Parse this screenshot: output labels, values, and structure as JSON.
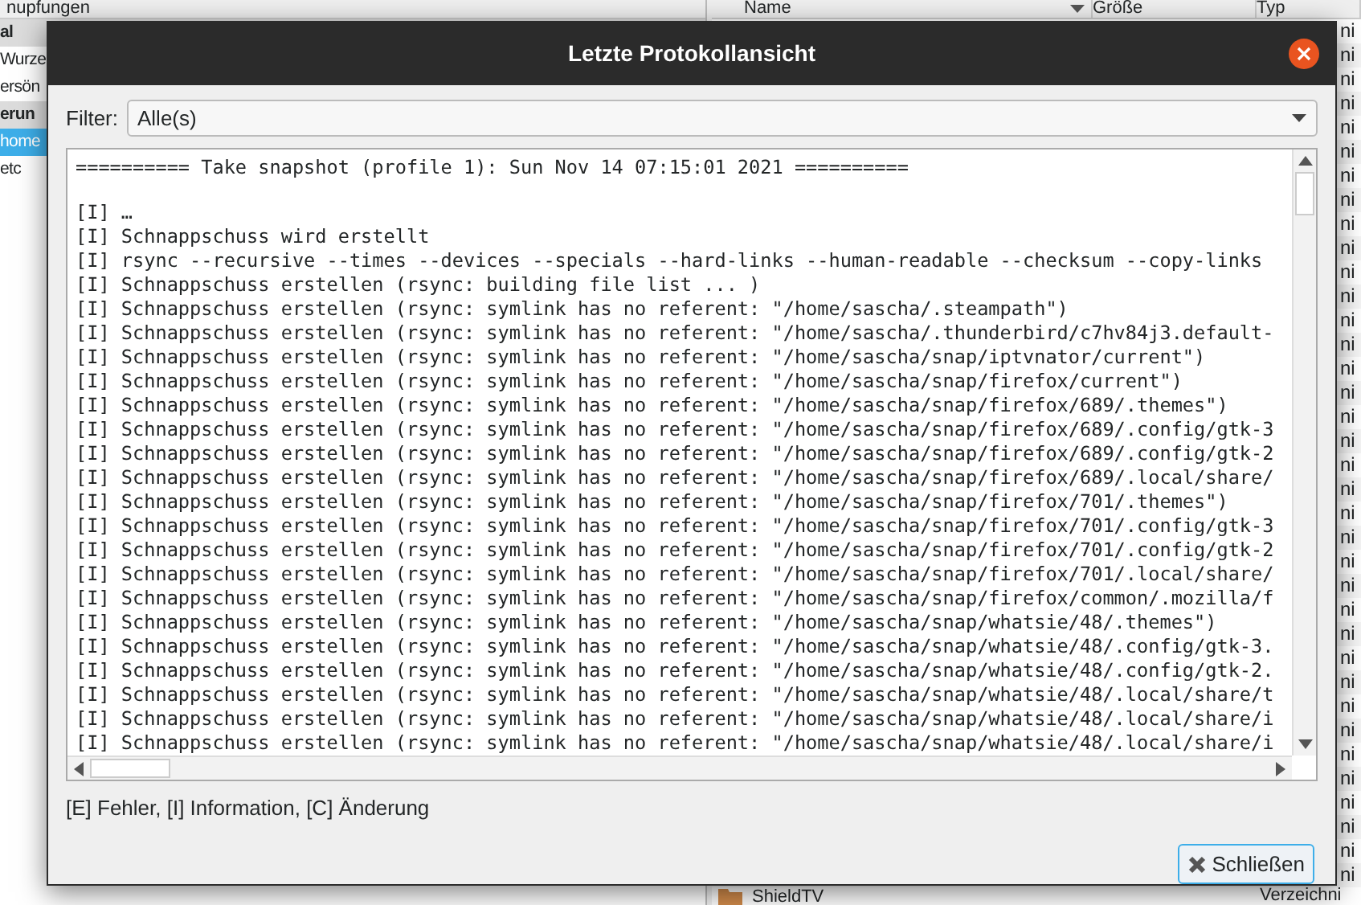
{
  "background_app": {
    "sidebar": {
      "header": "nupfungen",
      "items": [
        {
          "label": "al",
          "kind": "section",
          "selected": false
        },
        {
          "label": "Wurze",
          "kind": "item",
          "selected": false
        },
        {
          "label": "ersön",
          "kind": "item",
          "selected": false
        },
        {
          "label": "erun",
          "kind": "section",
          "selected": false
        },
        {
          "label": "home",
          "kind": "item",
          "selected": true
        },
        {
          "label": "etc",
          "kind": "item",
          "selected": false
        }
      ]
    },
    "file_list": {
      "columns": [
        "Name",
        "Größe",
        "Typ"
      ],
      "rows": [
        {
          "type": "ni"
        },
        {
          "type": "ni"
        },
        {
          "type": "ni"
        },
        {
          "type": "ni"
        },
        {
          "type": "ni"
        },
        {
          "type": "ni"
        },
        {
          "type": "ni"
        },
        {
          "type": "ni"
        },
        {
          "type": "ni"
        },
        {
          "type": "ni"
        },
        {
          "type": "ni"
        },
        {
          "type": "ni"
        },
        {
          "type": "ni"
        },
        {
          "type": "ni"
        },
        {
          "type": "ni"
        },
        {
          "type": "ni"
        },
        {
          "type": "ni"
        },
        {
          "type": "ni"
        },
        {
          "type": "ni"
        },
        {
          "type": "ni"
        },
        {
          "type": "ni"
        },
        {
          "type": "ni"
        },
        {
          "type": "ni"
        },
        {
          "type": "ni"
        },
        {
          "type": "ni"
        },
        {
          "type": "ni"
        },
        {
          "type": "ni"
        },
        {
          "type": "ni"
        },
        {
          "type": "ni"
        },
        {
          "type": "ni"
        },
        {
          "type": "ni"
        },
        {
          "type": "ni"
        },
        {
          "type": "ni"
        },
        {
          "type": "ni"
        },
        {
          "type": "ni"
        },
        {
          "type": "ni"
        },
        {
          "name": "ShieldTV",
          "type": "Verzeichni"
        }
      ]
    }
  },
  "dialog": {
    "title": "Letzte Protokollansicht",
    "filter": {
      "label": "Filter:",
      "value": "Alle(s)"
    },
    "log": {
      "header": "========== Take snapshot (profile 1): Sun Nov 14 07:15:01 2021 ==========",
      "lines": [
        "[I] …",
        "[I] Schnappschuss wird erstellt",
        "[I] rsync --recursive --times --devices --specials --hard-links --human-readable --checksum --copy-links",
        "[I] Schnappschuss erstellen (rsync: building file list ... )",
        "[I] Schnappschuss erstellen (rsync: symlink has no referent: \"/home/sascha/.steampath\")",
        "[I] Schnappschuss erstellen (rsync: symlink has no referent: \"/home/sascha/.thunderbird/c7hv84j3.default-",
        "[I] Schnappschuss erstellen (rsync: symlink has no referent: \"/home/sascha/snap/iptvnator/current\")",
        "[I] Schnappschuss erstellen (rsync: symlink has no referent: \"/home/sascha/snap/firefox/current\")",
        "[I] Schnappschuss erstellen (rsync: symlink has no referent: \"/home/sascha/snap/firefox/689/.themes\")",
        "[I] Schnappschuss erstellen (rsync: symlink has no referent: \"/home/sascha/snap/firefox/689/.config/gtk-3",
        "[I] Schnappschuss erstellen (rsync: symlink has no referent: \"/home/sascha/snap/firefox/689/.config/gtk-2",
        "[I] Schnappschuss erstellen (rsync: symlink has no referent: \"/home/sascha/snap/firefox/689/.local/share/",
        "[I] Schnappschuss erstellen (rsync: symlink has no referent: \"/home/sascha/snap/firefox/701/.themes\")",
        "[I] Schnappschuss erstellen (rsync: symlink has no referent: \"/home/sascha/snap/firefox/701/.config/gtk-3",
        "[I] Schnappschuss erstellen (rsync: symlink has no referent: \"/home/sascha/snap/firefox/701/.config/gtk-2",
        "[I] Schnappschuss erstellen (rsync: symlink has no referent: \"/home/sascha/snap/firefox/701/.local/share/",
        "[I] Schnappschuss erstellen (rsync: symlink has no referent: \"/home/sascha/snap/firefox/common/.mozilla/f",
        "[I] Schnappschuss erstellen (rsync: symlink has no referent: \"/home/sascha/snap/whatsie/48/.themes\")",
        "[I] Schnappschuss erstellen (rsync: symlink has no referent: \"/home/sascha/snap/whatsie/48/.config/gtk-3.",
        "[I] Schnappschuss erstellen (rsync: symlink has no referent: \"/home/sascha/snap/whatsie/48/.config/gtk-2.",
        "[I] Schnappschuss erstellen (rsync: symlink has no referent: \"/home/sascha/snap/whatsie/48/.local/share/t",
        "[I] Schnappschuss erstellen (rsync: symlink has no referent: \"/home/sascha/snap/whatsie/48/.local/share/i",
        "[I] Schnappschuss erstellen (rsync: symlink has no referent: \"/home/sascha/snap/whatsie/48/.local/share/i"
      ]
    },
    "legend": "[E] Fehler, [I] Information, [C] Änderung",
    "buttons": [
      {
        "label": "Schließen",
        "kind": "close"
      }
    ]
  }
}
